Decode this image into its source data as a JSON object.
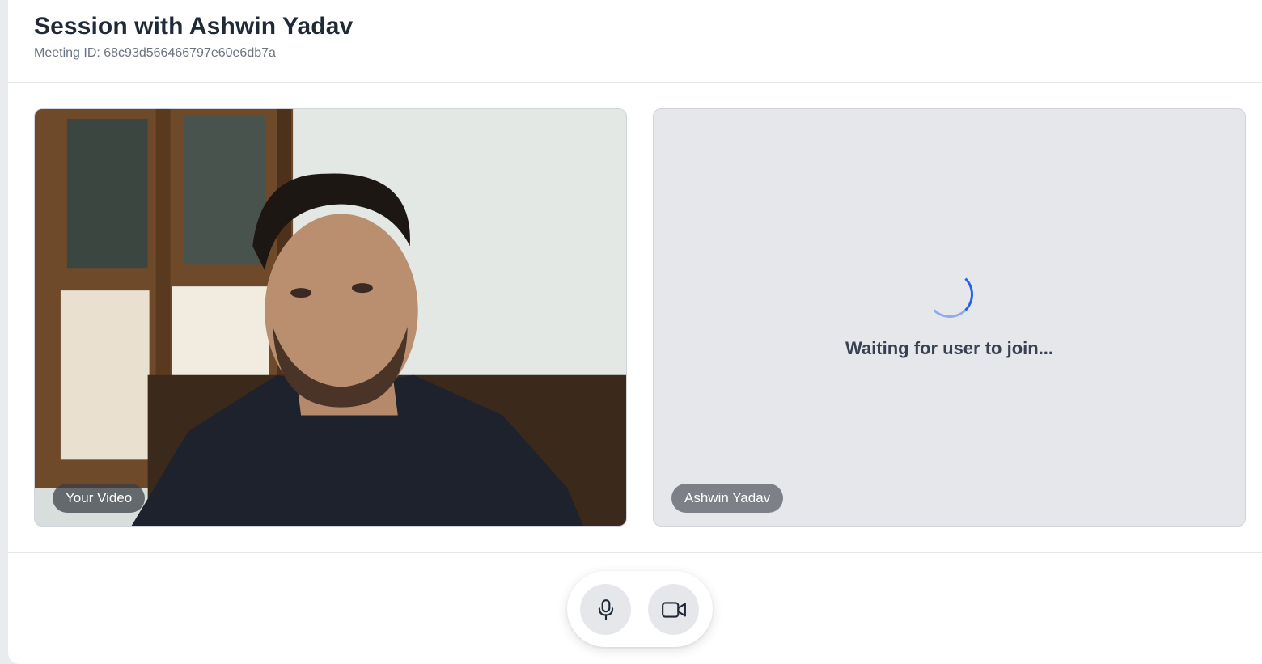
{
  "header": {
    "title": "Session with Ashwin Yadav",
    "meeting_id": "Meeting ID: 68c93d566466797e60e6db7a"
  },
  "local_tile": {
    "label": "Your Video"
  },
  "remote_tile": {
    "status": "Waiting for user to join...",
    "label": "Ashwin Yadav"
  },
  "controls": {
    "mic_icon": "microphone-icon",
    "camera_icon": "video-camera-icon"
  },
  "colors": {
    "accent": "#2563eb",
    "text_primary": "#1f2937",
    "text_secondary": "#6b7280",
    "tile_bg": "#e5e7eb"
  }
}
